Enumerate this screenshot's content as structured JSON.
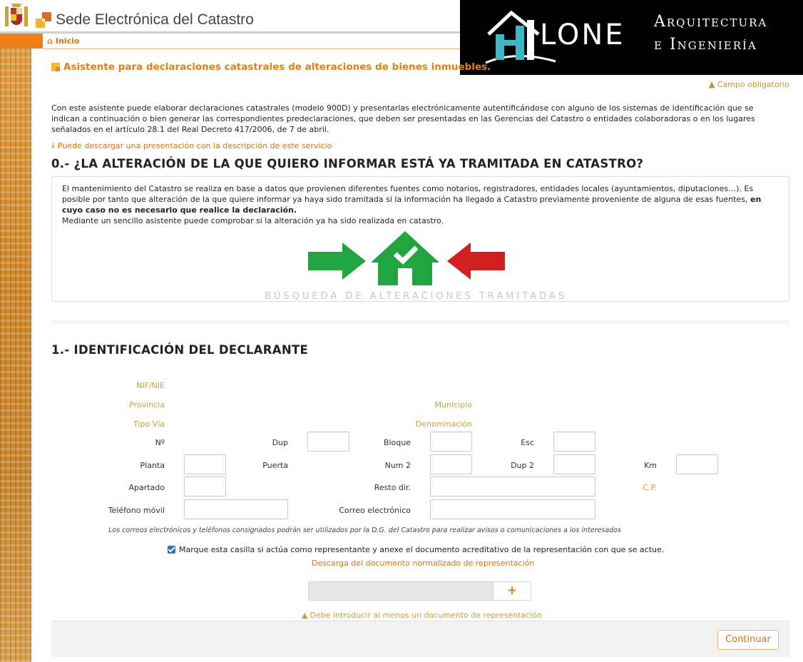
{
  "header": {
    "site_title": "Sede Electrónica del Catastro",
    "breadcrumb_home": "Inicio"
  },
  "banner": {
    "brand": "LONE",
    "tagline_1": "Arquitectura",
    "tagline_2": "e Ingeniería"
  },
  "assistant": {
    "title": "Asistente para declaraciones catastrales de alteraciones de bienes inmuebles.",
    "required_note": "Campo obligatorio",
    "intro": "Con este asistente puede elaborar declaraciones catastrales (modelo 900D) y presentarlas electrónicamente autentificándose con alguno de los sistemas de identificación que se indican a continuación o bien generar las correspondientes predeclaraciones, que deben ser presentadas en las Gerencias del Catastro o entidades colaboradoras o en los lugares señalados en el artículo 28.1 del Real Decreto 417/2006, de 7 de abril.",
    "download_link": "Puede descargar una presentación con la descripción de este servicio"
  },
  "section0": {
    "heading": "0.- ¿LA ALTERACIÓN DE LA QUE QUIERO INFORMAR ESTÁ YA TRAMITADA EN CATASTRO?",
    "text_part1": "El mantenimiento del Catastro se realiza en base a datos que provienen diferentes fuentes como notarios, registradores, entidades locales (ayuntamientos, diputaciones…). Es posible por tanto que alteración de la que quiere informar ya haya sido tramitada si la información ha llegado a Catastro previamente proveniente de alguna de esas fuentes, ",
    "text_bold": "en cuyo caso no es necesario que realice la declaración.",
    "text_part2": "Mediante un sencillo asistente puede comprobar si la alteración ya ha sido realizada en catastro.",
    "search_caption": "BÚSQUEDA DE ALTERACIONES TRAMITADAS"
  },
  "section1": {
    "heading": "1.- IDENTIFICACIÓN DEL DECLARANTE",
    "labels": {
      "nif": "NIF/NIE",
      "provincia": "Provincia",
      "municipio": "Municipio",
      "tipo_via": "Tipo Vía",
      "denominacion": "Denominación",
      "numero": "Nº",
      "dup": "Dup",
      "bloque": "Bloque",
      "esc": "Esc",
      "planta": "Planta",
      "puerta": "Puerta",
      "num2": "Num 2",
      "dup2": "Dup 2",
      "km": "Km",
      "apartado": "Apartado",
      "resto_dir": "Resto dir.",
      "cp": "C.P.",
      "telefono": "Teléfono móvil",
      "correo": "Correo electrónico"
    },
    "contact_note": "Los correos electrónicos y teléfonos consignados podrán ser utilizados por la D.G. del Catastro para realizar avisos o comunicaciones a los interesados",
    "representative_checkbox": "Marque esta casilla si actúa como representante y anexe el documento acreditativo de la representación con que se actue.",
    "representative_checked": true,
    "representative_download": "Descarga del documento normalizado de representación",
    "add_button": "+",
    "representative_warning": "Debe introducir al menos un documento de representación"
  },
  "footer": {
    "continue_label": "Continuar"
  },
  "colors": {
    "accent": "#e0820f",
    "gold_label": "#c4a23e",
    "banner_bg": "#000000",
    "checkbox": "#1e74d6"
  }
}
